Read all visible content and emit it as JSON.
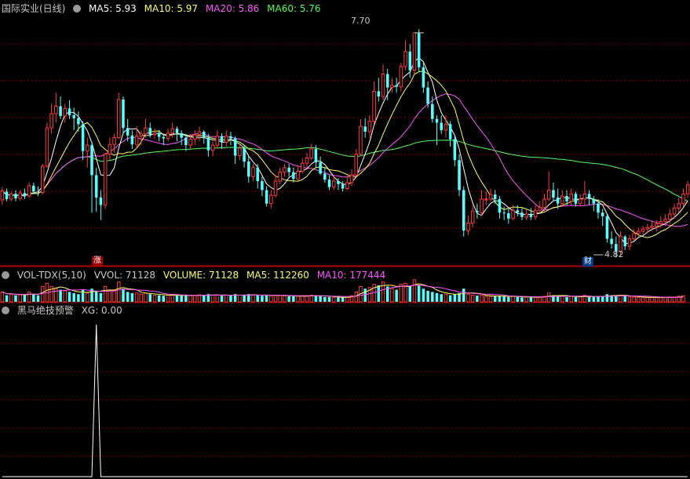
{
  "headers": {
    "main": {
      "stock": "国际实业(日线)",
      "ma5": "MA5: 5.93",
      "ma10": "MA10: 5.97",
      "ma20": "MA20: 5.86",
      "ma60": "MA60: 5.76"
    },
    "vol": {
      "name": "VOL-TDX(5,10)",
      "vvol": "VVOL: 71128",
      "volume": "VOLUME: 71128",
      "ma5": "MA5: 112260",
      "ma10": "MA10: 177444"
    },
    "ind": {
      "name": "黑马绝技预警",
      "xg": "XG: 0.00"
    }
  },
  "markers": {
    "high_label": "7.70",
    "low_label": "4.82",
    "zhang": "涨",
    "cai": "财"
  },
  "colors": {
    "up": "#ff3c3c",
    "down": "#54ffff",
    "ma5": "#ffffff",
    "ma10": "#ffff54",
    "ma20": "#ff54ff",
    "ma60": "#54ff54",
    "grid": "#8b0000",
    "text": "#c0c0c0"
  },
  "chart_data": {
    "type": "candlestick",
    "y_range": [
      4.6,
      7.95
    ],
    "candles": [
      [
        5.47,
        5.59,
        5.64,
        5.4
      ],
      [
        5.58,
        5.48,
        5.62,
        5.45
      ],
      [
        5.48,
        5.55,
        5.58,
        5.45
      ],
      [
        5.55,
        5.49,
        5.6,
        5.45
      ],
      [
        5.49,
        5.56,
        5.6,
        5.46
      ],
      [
        5.56,
        5.52,
        5.62,
        5.48
      ],
      [
        5.52,
        5.66,
        5.7,
        5.5
      ],
      [
        5.66,
        5.58,
        5.7,
        5.55
      ],
      [
        5.58,
        5.57,
        5.65,
        5.52
      ],
      [
        5.57,
        5.92,
        5.95,
        5.54
      ],
      [
        5.92,
        6.43,
        6.5,
        5.9
      ],
      [
        6.43,
        6.62,
        6.76,
        6.35
      ],
      [
        6.62,
        6.72,
        6.9,
        6.5
      ],
      [
        6.72,
        6.59,
        6.85,
        6.55
      ],
      [
        6.59,
        6.69,
        6.75,
        6.5
      ],
      [
        6.69,
        6.6,
        6.8,
        6.55
      ],
      [
        6.6,
        6.56,
        6.7,
        6.4
      ],
      [
        6.56,
        6.48,
        6.65,
        6.38
      ],
      [
        6.48,
        6.12,
        6.52,
        6.0
      ],
      [
        6.12,
        6.2,
        6.3,
        5.9
      ],
      [
        6.2,
        5.8,
        6.25,
        5.3
      ],
      [
        5.8,
        5.5,
        5.9,
        5.31
      ],
      [
        5.5,
        5.4,
        5.6,
        5.2
      ],
      [
        5.4,
        6.08,
        6.1,
        5.35
      ],
      [
        6.08,
        6.21,
        6.3,
        6.0
      ],
      [
        6.21,
        6.3,
        6.35,
        6.1
      ],
      [
        6.3,
        6.81,
        6.9,
        6.28
      ],
      [
        6.81,
        6.43,
        6.85,
        6.35
      ],
      [
        6.43,
        6.33,
        6.55,
        6.25
      ],
      [
        6.33,
        6.21,
        6.4,
        6.15
      ],
      [
        6.21,
        6.32,
        6.45,
        6.15
      ],
      [
        6.32,
        6.35,
        6.4,
        6.2
      ],
      [
        6.35,
        6.43,
        6.55,
        6.3
      ],
      [
        6.43,
        6.34,
        6.5,
        6.3
      ],
      [
        6.34,
        6.36,
        6.42,
        6.28
      ],
      [
        6.36,
        6.31,
        6.4,
        6.25
      ],
      [
        6.31,
        6.29,
        6.35,
        6.2
      ],
      [
        6.29,
        6.36,
        6.42,
        6.25
      ],
      [
        6.36,
        6.42,
        6.5,
        6.3
      ],
      [
        6.42,
        6.36,
        6.45,
        6.25
      ],
      [
        6.36,
        6.3,
        6.4,
        6.2
      ],
      [
        6.3,
        6.2,
        6.35,
        6.12
      ],
      [
        6.2,
        6.28,
        6.35,
        6.15
      ],
      [
        6.28,
        6.34,
        6.4,
        6.2
      ],
      [
        6.34,
        6.38,
        6.45,
        6.25
      ],
      [
        6.38,
        6.3,
        6.4,
        6.22
      ],
      [
        6.3,
        6.13,
        6.35,
        6.05
      ],
      [
        6.13,
        6.2,
        6.25,
        6.05
      ],
      [
        6.2,
        6.32,
        6.4,
        6.15
      ],
      [
        6.32,
        6.24,
        6.36,
        6.15
      ],
      [
        6.24,
        6.32,
        6.4,
        6.18
      ],
      [
        6.32,
        6.29,
        6.38,
        6.2
      ],
      [
        6.29,
        6.06,
        6.32,
        5.95
      ],
      [
        6.06,
        6.16,
        6.2,
        6.0
      ],
      [
        6.16,
        5.98,
        6.2,
        5.9
      ],
      [
        5.98,
        5.78,
        6.05,
        5.7
      ],
      [
        5.78,
        5.9,
        5.95,
        5.72
      ],
      [
        5.9,
        5.72,
        5.95,
        5.62
      ],
      [
        5.72,
        5.6,
        5.78,
        5.52
      ],
      [
        5.6,
        5.42,
        5.65,
        5.38
      ],
      [
        5.42,
        5.53,
        5.6,
        5.36
      ],
      [
        5.53,
        5.72,
        5.8,
        5.5
      ],
      [
        5.72,
        5.84,
        5.9,
        5.68
      ],
      [
        5.84,
        5.9,
        5.95,
        5.78
      ],
      [
        5.9,
        5.84,
        5.95,
        5.78
      ],
      [
        5.84,
        5.75,
        5.9,
        5.7
      ],
      [
        5.75,
        5.85,
        5.92,
        5.72
      ],
      [
        5.85,
        5.96,
        6.02,
        5.82
      ],
      [
        5.96,
        6.03,
        6.1,
        5.9
      ],
      [
        6.03,
        6.15,
        6.22,
        6.0
      ],
      [
        6.15,
        5.97,
        6.2,
        5.9
      ],
      [
        5.97,
        5.82,
        6.05,
        5.8
      ],
      [
        5.82,
        5.74,
        5.9,
        5.7
      ],
      [
        5.74,
        5.64,
        5.8,
        5.6
      ],
      [
        5.64,
        5.72,
        5.8,
        5.6
      ],
      [
        5.72,
        5.68,
        5.76,
        5.6
      ],
      [
        5.68,
        5.62,
        5.72,
        5.58
      ],
      [
        5.62,
        5.7,
        5.8,
        5.6
      ],
      [
        5.7,
        5.8,
        5.88,
        5.65
      ],
      [
        5.8,
        6.08,
        6.15,
        5.78
      ],
      [
        6.08,
        6.45,
        6.55,
        6.05
      ],
      [
        6.45,
        6.38,
        6.56,
        6.3
      ],
      [
        6.38,
        6.52,
        6.6,
        6.3
      ],
      [
        6.52,
        6.92,
        7.05,
        6.48
      ],
      [
        6.92,
        6.85,
        7.1,
        6.78
      ],
      [
        6.85,
        7.15,
        7.28,
        6.8
      ],
      [
        7.15,
        6.97,
        7.22,
        6.8
      ],
      [
        6.97,
        7.0,
        7.1,
        6.9
      ],
      [
        7.0,
        6.98,
        7.1,
        6.9
      ],
      [
        6.98,
        7.25,
        7.3,
        6.92
      ],
      [
        7.25,
        7.45,
        7.6,
        7.2
      ],
      [
        7.45,
        7.2,
        7.55,
        7.1
      ],
      [
        7.2,
        7.7,
        7.7,
        7.15
      ],
      [
        7.7,
        7.24,
        7.75,
        7.18
      ],
      [
        7.24,
        6.97,
        7.3,
        6.9
      ],
      [
        6.97,
        6.75,
        7.05,
        6.7
      ],
      [
        6.75,
        6.55,
        6.85,
        6.5
      ],
      [
        6.55,
        6.5,
        6.6,
        6.2
      ],
      [
        6.5,
        6.4,
        6.6,
        6.35
      ],
      [
        6.4,
        6.48,
        6.6,
        6.3
      ],
      [
        6.48,
        6.28,
        6.52,
        6.18
      ],
      [
        6.28,
        6.0,
        6.32,
        5.92
      ],
      [
        6.0,
        5.6,
        6.08,
        5.52
      ],
      [
        5.6,
        5.06,
        5.65,
        4.98
      ],
      [
        5.06,
        5.16,
        5.26,
        5.0
      ],
      [
        5.16,
        5.32,
        5.4,
        5.1
      ],
      [
        5.32,
        5.3,
        5.42,
        5.22
      ],
      [
        5.3,
        5.48,
        5.6,
        5.25
      ],
      [
        5.48,
        5.48,
        5.58,
        5.4
      ],
      [
        5.48,
        5.54,
        5.62,
        5.45
      ],
      [
        5.54,
        5.48,
        5.6,
        5.42
      ],
      [
        5.48,
        5.3,
        5.52,
        5.22
      ],
      [
        5.3,
        5.29,
        5.38,
        5.2
      ],
      [
        5.29,
        5.22,
        5.35,
        5.15
      ],
      [
        5.22,
        5.33,
        5.4,
        5.2
      ],
      [
        5.33,
        5.3,
        5.4,
        5.25
      ],
      [
        5.3,
        5.24,
        5.36,
        5.2
      ],
      [
        5.24,
        5.28,
        5.34,
        5.2
      ],
      [
        5.28,
        5.24,
        5.36,
        5.2
      ],
      [
        5.24,
        5.33,
        5.4,
        5.2
      ],
      [
        5.33,
        5.37,
        5.45,
        5.3
      ],
      [
        5.37,
        5.48,
        5.55,
        5.32
      ],
      [
        5.48,
        5.6,
        5.85,
        5.45
      ],
      [
        5.6,
        5.5,
        5.7,
        5.45
      ],
      [
        5.5,
        5.42,
        5.62,
        5.35
      ],
      [
        5.42,
        5.52,
        5.6,
        5.38
      ],
      [
        5.52,
        5.45,
        5.6,
        5.4
      ],
      [
        5.45,
        5.55,
        5.62,
        5.4
      ],
      [
        5.55,
        5.42,
        5.58,
        5.38
      ],
      [
        5.42,
        5.48,
        5.55,
        5.38
      ],
      [
        5.48,
        5.55,
        5.72,
        5.4
      ],
      [
        5.55,
        5.48,
        5.6,
        5.4
      ],
      [
        5.48,
        5.42,
        5.52,
        5.32
      ],
      [
        5.42,
        5.3,
        5.48,
        5.22
      ],
      [
        5.3,
        5.25,
        5.35,
        5.12
      ],
      [
        5.25,
        4.95,
        5.28,
        4.9
      ],
      [
        4.95,
        4.88,
        5.05,
        4.82
      ],
      [
        4.88,
        4.78,
        4.98,
        4.7
      ],
      [
        4.78,
        4.98,
        5.05,
        4.72
      ],
      [
        4.98,
        4.85,
        5.0,
        4.8
      ],
      [
        4.85,
        4.95,
        5.0,
        4.8
      ],
      [
        4.95,
        5.02,
        5.08,
        4.92
      ],
      [
        5.02,
        5.05,
        5.1,
        4.98
      ],
      [
        5.05,
        5.08,
        5.12,
        5.0
      ],
      [
        5.08,
        5.1,
        5.15,
        5.02
      ],
      [
        5.1,
        5.12,
        5.18,
        5.05
      ],
      [
        5.12,
        5.15,
        5.2,
        5.05
      ],
      [
        5.15,
        5.18,
        5.25,
        5.1
      ],
      [
        5.18,
        5.21,
        5.28,
        5.12
      ],
      [
        5.21,
        5.28,
        5.35,
        5.15
      ],
      [
        5.28,
        5.36,
        5.42,
        5.22
      ],
      [
        5.36,
        5.42,
        5.5,
        5.3
      ],
      [
        5.42,
        5.55,
        5.62,
        5.38
      ],
      [
        5.55,
        5.67,
        5.72,
        5.5
      ]
    ],
    "volume_ratio": [
      0.45,
      0.3,
      0.35,
      0.3,
      0.32,
      0.3,
      0.45,
      0.35,
      0.3,
      0.7,
      0.85,
      0.7,
      0.6,
      0.55,
      0.5,
      0.45,
      0.4,
      0.35,
      0.55,
      0.4,
      0.6,
      0.5,
      0.4,
      0.7,
      0.5,
      0.55,
      0.9,
      0.6,
      0.45,
      0.4,
      0.4,
      0.35,
      0.4,
      0.35,
      0.3,
      0.3,
      0.28,
      0.3,
      0.32,
      0.3,
      0.28,
      0.3,
      0.28,
      0.3,
      0.32,
      0.28,
      0.35,
      0.3,
      0.32,
      0.28,
      0.3,
      0.28,
      0.35,
      0.3,
      0.3,
      0.35,
      0.3,
      0.3,
      0.28,
      0.3,
      0.28,
      0.3,
      0.3,
      0.28,
      0.25,
      0.25,
      0.25,
      0.28,
      0.28,
      0.3,
      0.3,
      0.25,
      0.22,
      0.22,
      0.2,
      0.2,
      0.2,
      0.22,
      0.28,
      0.45,
      0.7,
      0.6,
      0.65,
      0.8,
      0.75,
      0.9,
      0.7,
      0.6,
      0.55,
      0.8,
      0.85,
      0.7,
      1.0,
      0.75,
      0.6,
      0.5,
      0.45,
      0.4,
      0.35,
      0.35,
      0.3,
      0.35,
      0.4,
      0.6,
      0.35,
      0.3,
      0.28,
      0.3,
      0.25,
      0.25,
      0.25,
      0.28,
      0.25,
      0.22,
      0.25,
      0.22,
      0.2,
      0.22,
      0.2,
      0.22,
      0.22,
      0.25,
      0.4,
      0.3,
      0.25,
      0.25,
      0.22,
      0.25,
      0.22,
      0.22,
      0.3,
      0.22,
      0.22,
      0.25,
      0.25,
      0.35,
      0.3,
      0.3,
      0.3,
      0.25,
      0.22,
      0.22,
      0.2,
      0.2,
      0.2,
      0.2,
      0.2,
      0.2,
      0.2,
      0.22,
      0.22,
      0.25,
      0.28
    ],
    "xg_signal_index": 21,
    "annotations": {
      "high": {
        "index": 92,
        "value": 7.7
      },
      "low": {
        "index": 132,
        "value": 4.82
      }
    }
  }
}
